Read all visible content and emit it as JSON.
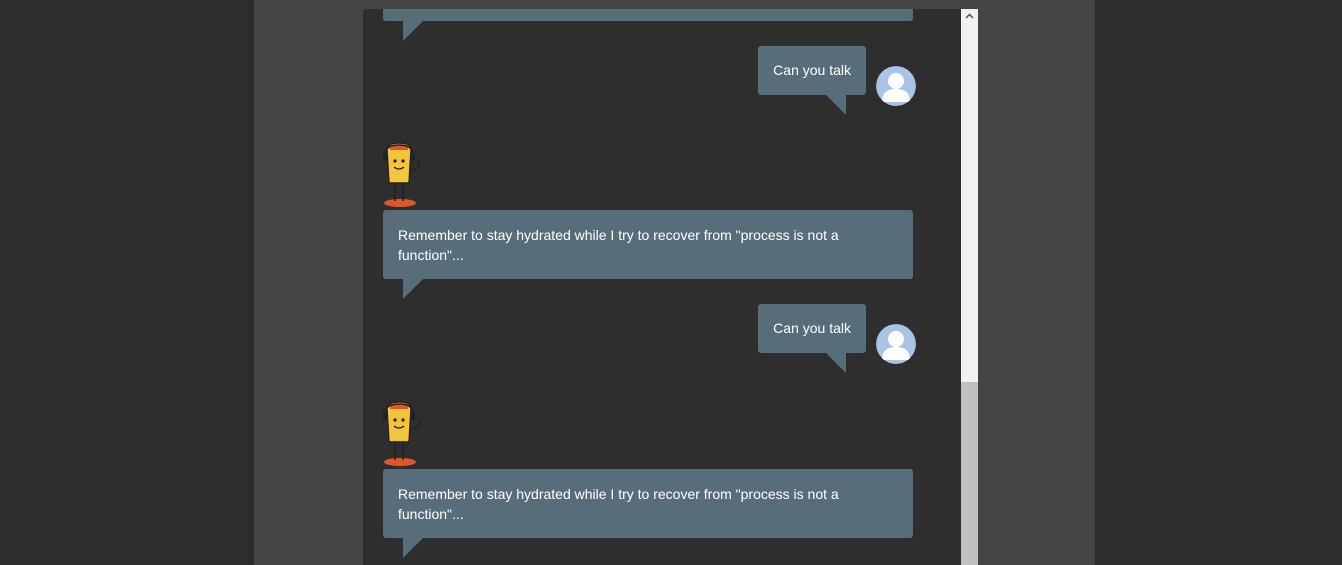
{
  "chat": {
    "messages": [
      {
        "sender": "bot",
        "text": ""
      },
      {
        "sender": "user",
        "text": "Can you talk"
      },
      {
        "sender": "bot",
        "text": "Remember to stay hydrated while I try to recover from \"process is not a function\"..."
      },
      {
        "sender": "user",
        "text": "Can you talk"
      },
      {
        "sender": "bot",
        "text": "Remember to stay hydrated while I try to recover from \"process is not a function\"..."
      }
    ]
  },
  "colors": {
    "background": "#2c2c2c",
    "panel": "#454545",
    "chat_background": "#2e2e2e",
    "bubble": "#576d7a",
    "bubble_text": "#ffffff",
    "user_avatar": "#a9c3e6"
  },
  "icons": {
    "user_avatar": "user-avatar-icon",
    "bot_avatar": "robot-mascot-icon",
    "scroll_up": "chevron-up-icon"
  }
}
